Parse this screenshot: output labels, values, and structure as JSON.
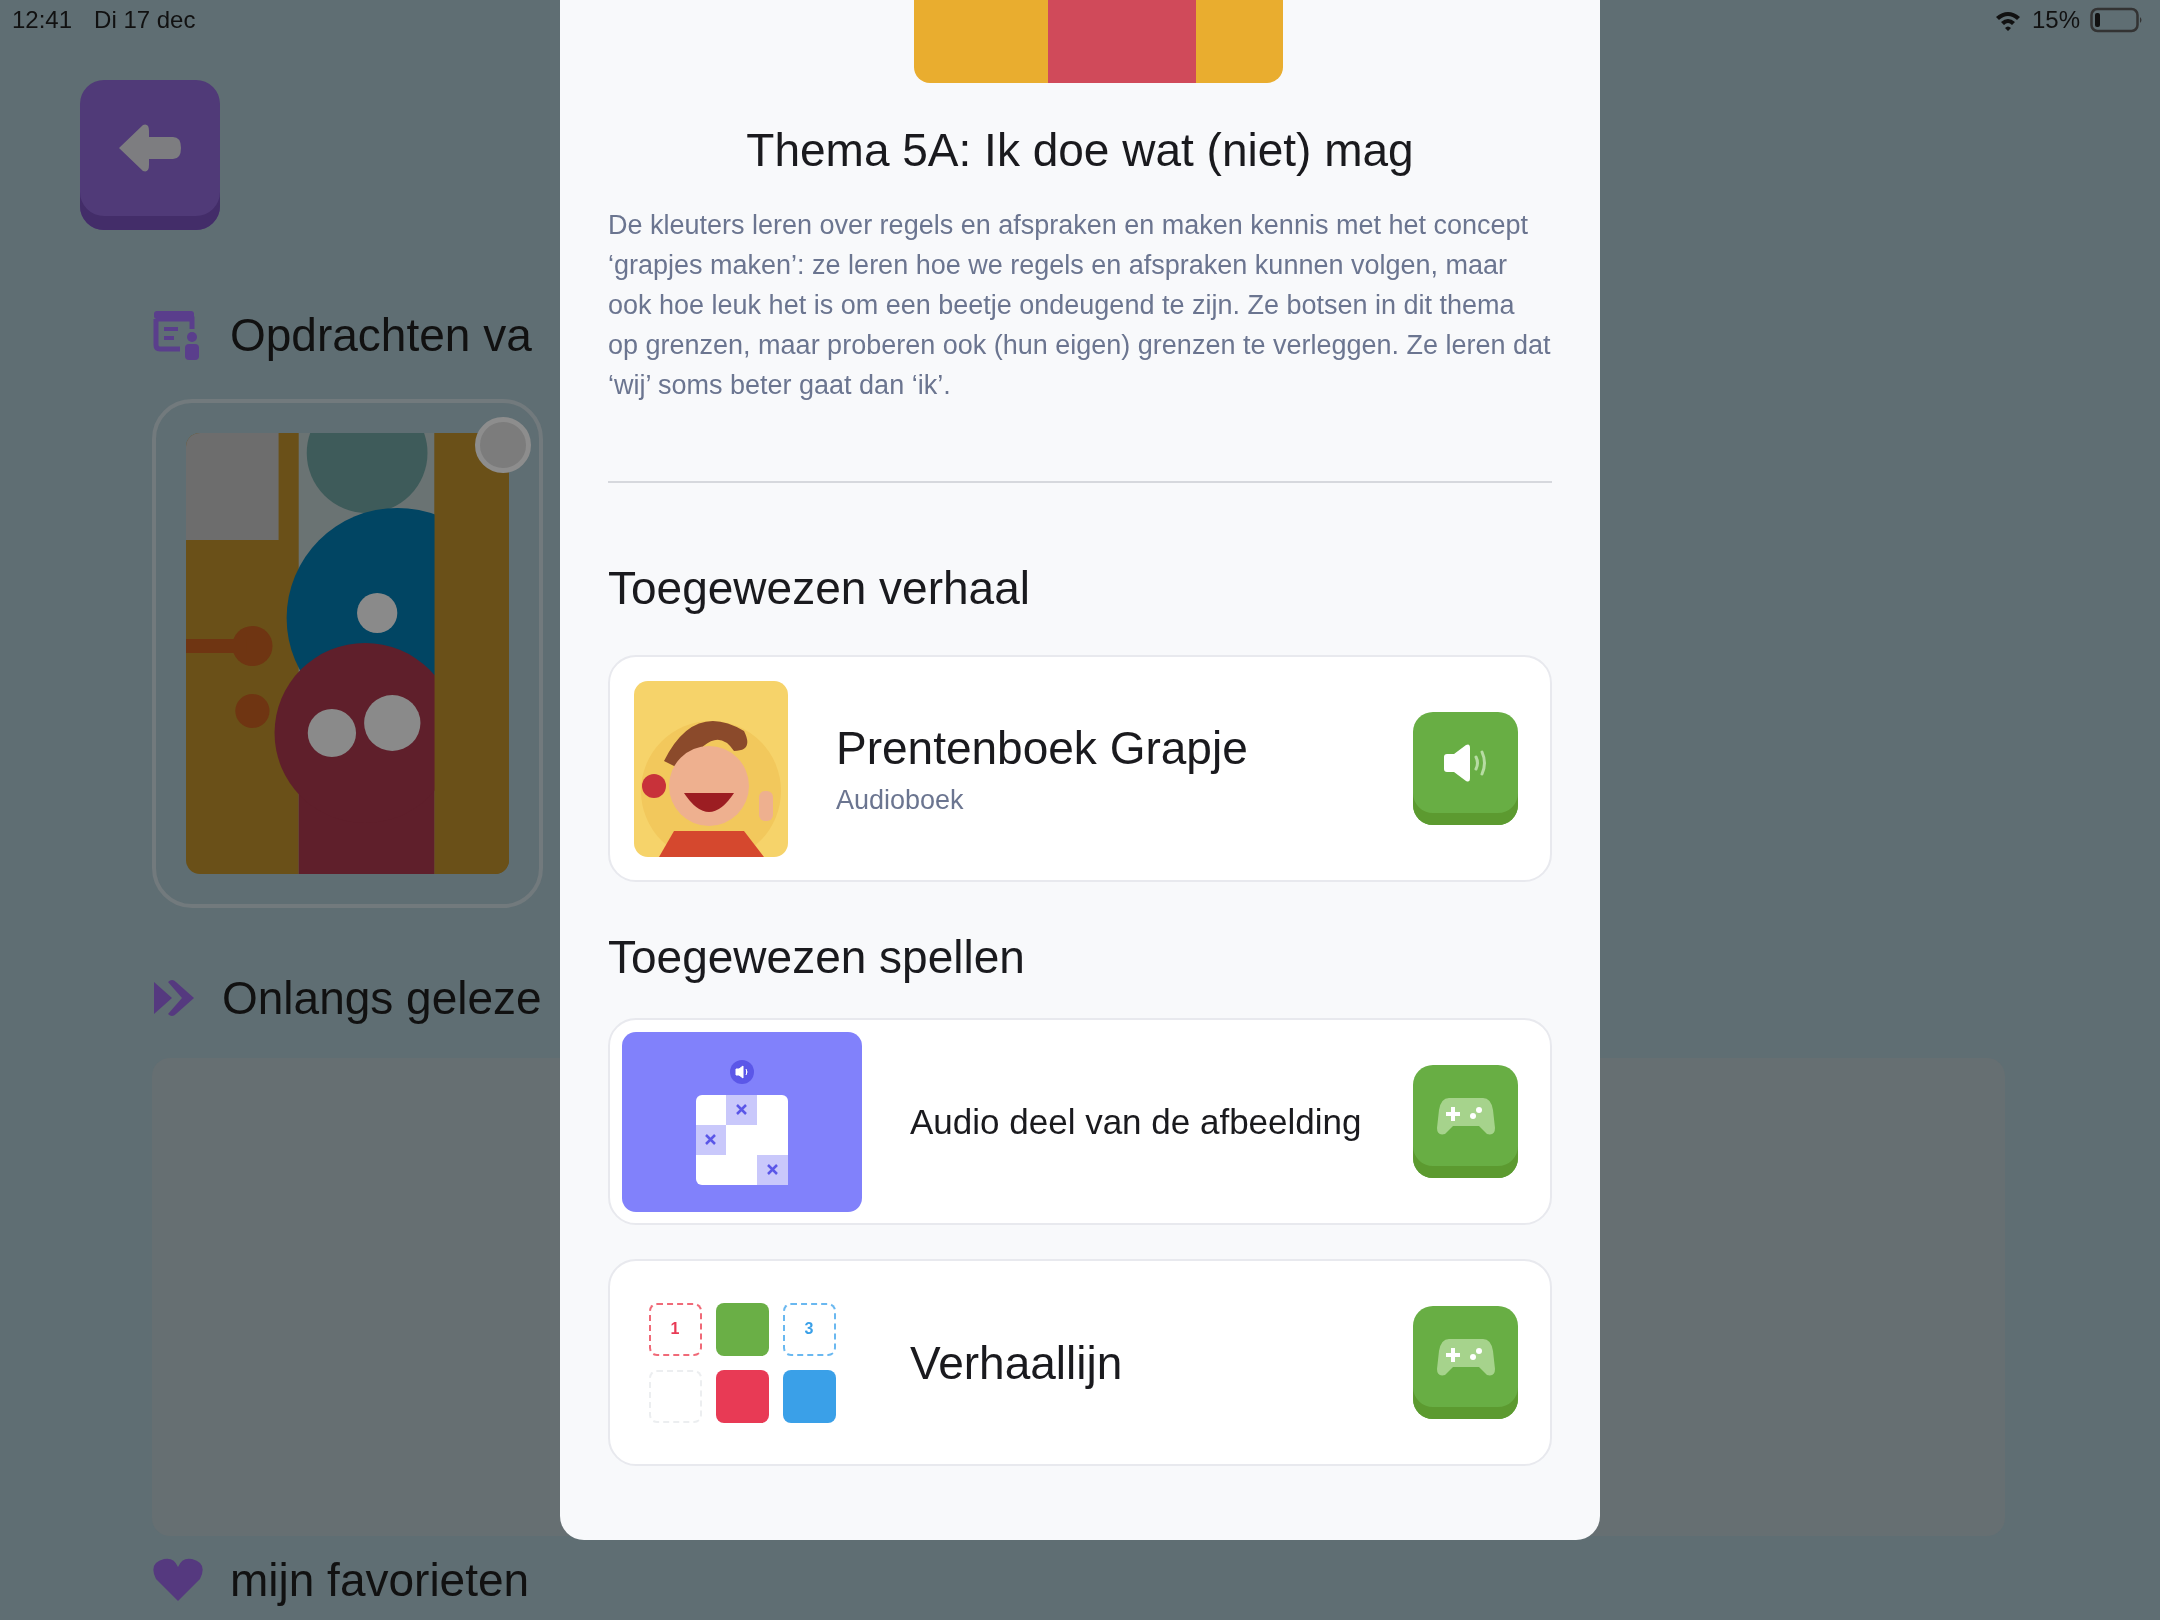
{
  "status_bar": {
    "time": "12:41",
    "date": "Di 17 dec",
    "battery": "15%"
  },
  "background": {
    "sections": [
      {
        "kind": "assignments",
        "title": "Opdrachten va"
      },
      {
        "kind": "recent",
        "title": "Onlangs geleze"
      },
      {
        "kind": "favorites",
        "title": "mijn favorieten"
      }
    ]
  },
  "modal": {
    "title": "Thema 5A: Ik doe wat (niet) mag",
    "description": "De kleuters leren over regels en afspraken en maken kennis met het concept ‘grapjes maken’: ze leren hoe we regels en afspraken kunnen volgen, maar ook hoe leuk het is om een beetje ondeugend te zijn. Ze botsen in dit thema op grenzen, maar proberen ook (hun eigen) grenzen te verleggen. Ze leren dat ‘wij’ soms beter gaat dan ‘ik’.",
    "story_heading": "Toegewezen verhaal",
    "story": {
      "title": "Prentenboek Grapje",
      "subtitle": "Audioboek"
    },
    "games_heading": "Toegewezen spellen",
    "games": [
      {
        "kind": "image-parts",
        "title": "Audio deel van de afbeelding"
      },
      {
        "kind": "storyline",
        "title": "Verhaallijn",
        "labels": [
          "1",
          "3"
        ]
      }
    ]
  }
}
